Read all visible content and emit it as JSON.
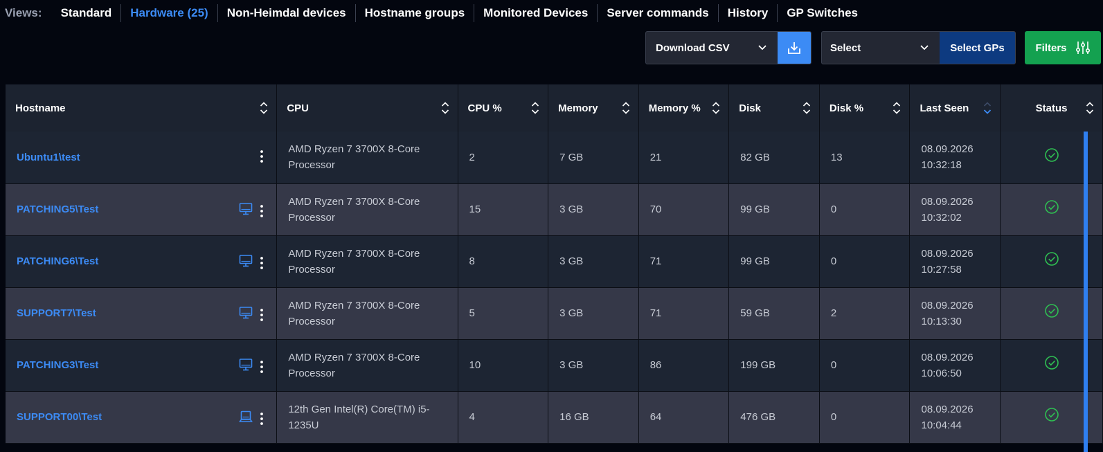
{
  "views": {
    "label": "Views:",
    "tabs": [
      {
        "label": "Standard"
      },
      {
        "label": "Hardware (25)"
      },
      {
        "label": "Non-Heimdal devices"
      },
      {
        "label": "Hostname groups"
      },
      {
        "label": "Monitored Devices"
      },
      {
        "label": "Server commands"
      },
      {
        "label": "History"
      },
      {
        "label": "GP Switches"
      }
    ],
    "active_index": 1
  },
  "toolbar": {
    "download_csv_label": "Download CSV",
    "download_icon": "download-icon",
    "select_label": "Select",
    "select_gps_label": "Select GPs",
    "filters_label": "Filters",
    "filters_icon": "sliders-icon"
  },
  "colors": {
    "accent_blue": "#3c8bf5",
    "dark_blue_button": "#0d3a80",
    "green_button": "#14a150",
    "status_ok": "#2fbf52"
  },
  "table": {
    "columns": [
      {
        "label": "Hostname"
      },
      {
        "label": "CPU"
      },
      {
        "label": "CPU %"
      },
      {
        "label": "Memory"
      },
      {
        "label": "Memory %"
      },
      {
        "label": "Disk"
      },
      {
        "label": "Disk %"
      },
      {
        "label": "Last Seen",
        "sorted": "desc"
      },
      {
        "label": "Status"
      }
    ],
    "rows": [
      {
        "hostname": "Ubuntu1\\test",
        "device_icon": "",
        "cpu": "AMD Ryzen 7 3700X 8-Core Processor",
        "cpu_pct": "2",
        "memory": "7 GB",
        "memory_pct": "21",
        "disk": "82 GB",
        "disk_pct": "13",
        "last_seen_date": "08.09.2026",
        "last_seen_time": "10:32:18",
        "status": "ok"
      },
      {
        "hostname": "PATCHING5\\Test",
        "device_icon": "desktop-icon",
        "cpu": "AMD Ryzen 7 3700X 8-Core Processor",
        "cpu_pct": "15",
        "memory": "3 GB",
        "memory_pct": "70",
        "disk": "99 GB",
        "disk_pct": "0",
        "last_seen_date": "08.09.2026",
        "last_seen_time": "10:32:02",
        "status": "ok"
      },
      {
        "hostname": "PATCHING6\\Test",
        "device_icon": "desktop-icon",
        "cpu": "AMD Ryzen 7 3700X 8-Core Processor",
        "cpu_pct": "8",
        "memory": "3 GB",
        "memory_pct": "71",
        "disk": "99 GB",
        "disk_pct": "0",
        "last_seen_date": "08.09.2026",
        "last_seen_time": "10:27:58",
        "status": "ok"
      },
      {
        "hostname": "SUPPORT7\\Test",
        "device_icon": "desktop-icon",
        "cpu": "AMD Ryzen 7 3700X 8-Core Processor",
        "cpu_pct": "5",
        "memory": "3 GB",
        "memory_pct": "71",
        "disk": "59 GB",
        "disk_pct": "2",
        "last_seen_date": "08.09.2026",
        "last_seen_time": "10:13:30",
        "status": "ok"
      },
      {
        "hostname": "PATCHING3\\Test",
        "device_icon": "desktop-icon",
        "cpu": "AMD Ryzen 7 3700X 8-Core Processor",
        "cpu_pct": "10",
        "memory": "3 GB",
        "memory_pct": "86",
        "disk": "199 GB",
        "disk_pct": "0",
        "last_seen_date": "08.09.2026",
        "last_seen_time": "10:06:50",
        "status": "ok"
      },
      {
        "hostname": "SUPPORT00\\Test",
        "device_icon": "laptop-icon",
        "cpu": "12th Gen Intel(R) Core(TM) i5-1235U",
        "cpu_pct": "4",
        "memory": "16 GB",
        "memory_pct": "64",
        "disk": "476 GB",
        "disk_pct": "0",
        "last_seen_date": "08.09.2026",
        "last_seen_time": "10:04:44",
        "status": "ok"
      }
    ]
  }
}
